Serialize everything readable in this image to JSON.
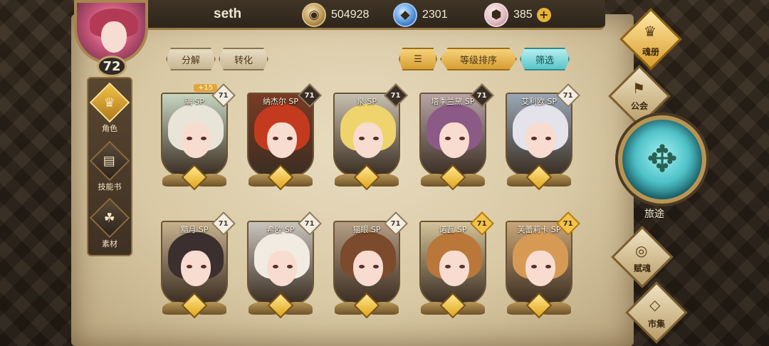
{
  "player": {
    "name": "seth",
    "level": "72"
  },
  "currencies": [
    {
      "icon": "gold-coin-icon",
      "value": "504928"
    },
    {
      "icon": "blue-crystal-icon",
      "value": "2301"
    },
    {
      "icon": "pink-gem-icon",
      "value": "385",
      "plus": "+"
    }
  ],
  "toolbar": {
    "decompose": "分解",
    "convert": "转化",
    "sort_level": "等级排序",
    "filter": "筛选"
  },
  "left_tabs": [
    {
      "label": "角色",
      "icon": "helmet-icon",
      "active": true
    },
    {
      "label": "技能书",
      "icon": "book-icon",
      "active": false
    },
    {
      "label": "素材",
      "icon": "creature-icon",
      "active": false
    }
  ],
  "cards": [
    {
      "name": "璃 SP",
      "level": "71",
      "tag": "light",
      "bonus": "+15",
      "hair": "#e9e4d8",
      "bg": "#c6d6c0"
    },
    {
      "name": "纳杰尔 SP",
      "level": "71",
      "tag": "dark",
      "hair": "#c43a1e",
      "bg": "#7a3b24"
    },
    {
      "name": "泉 SP",
      "level": "71",
      "tag": "dark",
      "hair": "#efd36c",
      "bg": "#c7bfb0"
    },
    {
      "name": "塔季兰黛 SP",
      "level": "71",
      "tag": "dark",
      "hair": "#8c5a86",
      "bg": "#b8a4a8"
    },
    {
      "name": "艾利欧 SP",
      "level": "71",
      "tag": "light",
      "hair": "#e4e2ea",
      "bg": "#9aa7b6"
    },
    {
      "name": "黯月 SP",
      "level": "71",
      "tag": "light",
      "hair": "#3b2f2f",
      "bg": "#c7b18d"
    },
    {
      "name": "希欧 SP",
      "level": "71",
      "tag": "light",
      "hair": "#f1ebe2",
      "bg": "#c9c5bd"
    },
    {
      "name": "猫眼 SP",
      "level": "71",
      "tag": "light",
      "hair": "#7c4a2c",
      "bg": "#b59d84"
    },
    {
      "name": "诺瓦 SP",
      "level": "71",
      "tag": "gold",
      "hair": "#b9773a",
      "bg": "#d4c39a"
    },
    {
      "name": "芙蕾莉卡 SP",
      "level": "71",
      "tag": "gold",
      "hair": "#d79a55",
      "bg": "#caa677"
    }
  ],
  "right_menu": {
    "soul_book": "魂册",
    "guild": "公会",
    "journey": "旅途",
    "soul_grant": "赋魂",
    "market": "市集"
  }
}
